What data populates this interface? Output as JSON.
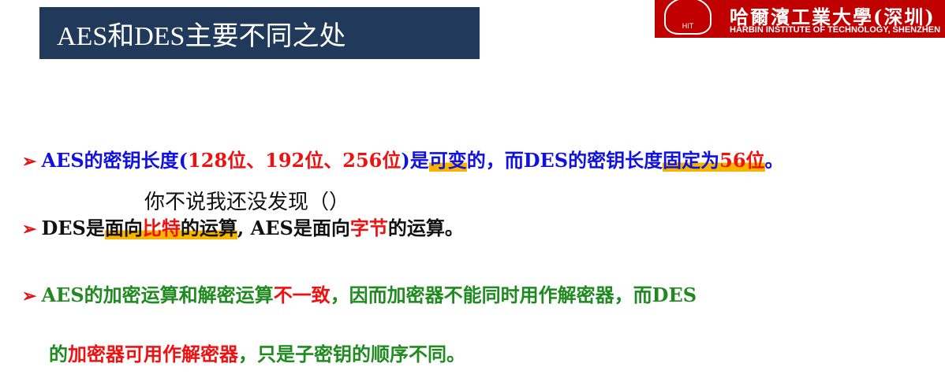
{
  "title": "AES和DES主要不同之处",
  "logo": {
    "emblem": "HIT",
    "cn": "哈爾濱工業大學(深圳)",
    "en": "HARBIN INSTITUTE OF TECHNOLOGY, SHENZHEN"
  },
  "bullet_icon": "arrow-bullet-icon",
  "b1": [
    "AES的密钥长度(",
    "128位、192位、256位",
    ")是",
    "可变",
    "的，而DES的密钥长度",
    "固定为",
    "56位",
    "。"
  ],
  "note": "你不说我还没发现（）",
  "b2": [
    "DES是",
    "面向",
    "比特",
    "的运算",
    ", AES是面向",
    "字节",
    "的运算。"
  ],
  "b3": [
    "AES的加密运算和解密运算",
    "不一致",
    "，因而加密器不能同时用作解密器，而DES"
  ],
  "b4": [
    "的",
    "加密器可用作解密器",
    "，只是子密钥的顺序不同。"
  ],
  "colors": {
    "title_bg": "#213a5c",
    "logo_bg": "#c00000",
    "highlight": "#f7b500"
  }
}
